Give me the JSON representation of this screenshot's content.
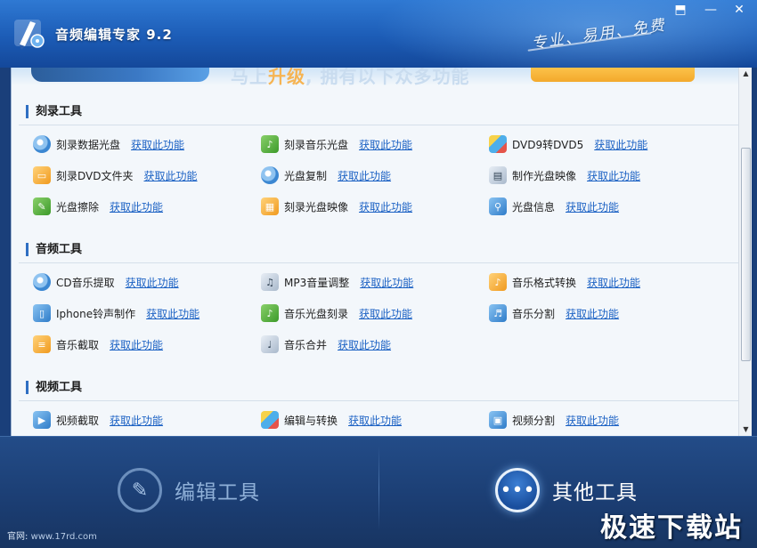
{
  "window": {
    "title": "音频编辑专家 9.2",
    "slogan": "专业、易用、免费",
    "controls": {
      "minimize": "⬒",
      "restore": "—",
      "close": "✕"
    }
  },
  "banner": {
    "text_prefix": "马上",
    "text_highlight": "升级",
    "text_suffix": ", 拥有以下众多功能"
  },
  "sections": [
    {
      "title": "刻录工具",
      "items": [
        {
          "name": "刻录数据光盘",
          "link": "获取此功能",
          "icon": "disc-data-icon"
        },
        {
          "name": "刻录音乐光盘",
          "link": "获取此功能",
          "icon": "disc-music-icon"
        },
        {
          "name": "DVD9转DVD5",
          "link": "获取此功能",
          "icon": "dvd-convert-icon"
        },
        {
          "name": "刻录DVD文件夹",
          "link": "获取此功能",
          "icon": "dvd-folder-icon"
        },
        {
          "name": "光盘复制",
          "link": "获取此功能",
          "icon": "disc-copy-icon"
        },
        {
          "name": "制作光盘映像",
          "link": "获取此功能",
          "icon": "disc-image-icon"
        },
        {
          "name": "光盘擦除",
          "link": "获取此功能",
          "icon": "disc-erase-icon"
        },
        {
          "name": "刻录光盘映像",
          "link": "获取此功能",
          "icon": "burn-image-icon"
        },
        {
          "name": "光盘信息",
          "link": "获取此功能",
          "icon": "disc-info-icon"
        }
      ]
    },
    {
      "title": "音频工具",
      "items": [
        {
          "name": "CD音乐提取",
          "link": "获取此功能",
          "icon": "cd-rip-icon"
        },
        {
          "name": "MP3音量调整",
          "link": "获取此功能",
          "icon": "volume-icon"
        },
        {
          "name": "音乐格式转换",
          "link": "获取此功能",
          "icon": "music-convert-icon"
        },
        {
          "name": "Iphone铃声制作",
          "link": "获取此功能",
          "icon": "iphone-icon"
        },
        {
          "name": "音乐光盘刻录",
          "link": "获取此功能",
          "icon": "music-burn-icon"
        },
        {
          "name": "音乐分割",
          "link": "获取此功能",
          "icon": "music-split-icon"
        },
        {
          "name": "音乐截取",
          "link": "获取此功能",
          "icon": "music-cut-icon"
        },
        {
          "name": "音乐合并",
          "link": "获取此功能",
          "icon": "music-merge-icon"
        }
      ]
    },
    {
      "title": "视频工具",
      "items": [
        {
          "name": "视频截取",
          "link": "获取此功能",
          "icon": "video-cut-icon"
        },
        {
          "name": "编辑与转换",
          "link": "获取此功能",
          "icon": "video-edit-icon"
        },
        {
          "name": "视频分割",
          "link": "获取此功能",
          "icon": "video-split-icon"
        }
      ]
    }
  ],
  "bottom_tabs": [
    {
      "label": "编辑工具",
      "icon": "pen-icon",
      "active": false
    },
    {
      "label": "其他工具",
      "icon": "more-dots-icon",
      "active": true
    }
  ],
  "footer": {
    "website_label": "官网:",
    "website_url": "www.17rd.com",
    "watermark": "极速下载站"
  }
}
